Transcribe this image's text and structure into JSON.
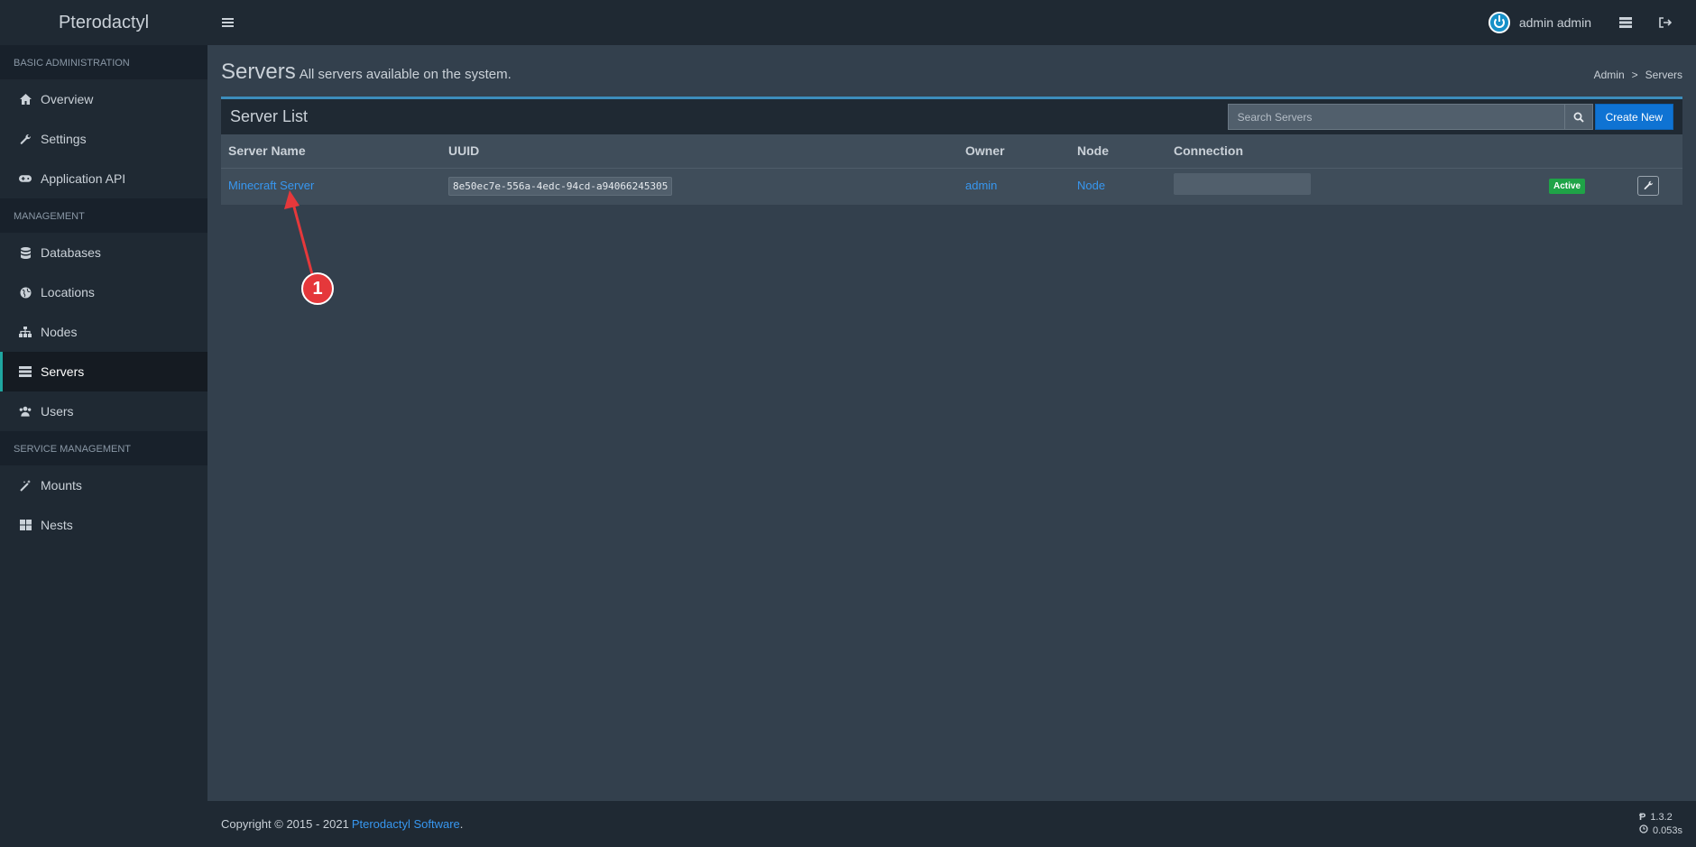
{
  "app": {
    "brand": "Pterodactyl"
  },
  "header": {
    "user_name": "admin admin"
  },
  "sidebar": {
    "sections": [
      {
        "title": "BASIC ADMINISTRATION",
        "items": [
          {
            "label": "Overview",
            "icon": "home-icon"
          },
          {
            "label": "Settings",
            "icon": "wrench-icon"
          },
          {
            "label": "Application API",
            "icon": "gamepad-icon"
          }
        ]
      },
      {
        "title": "MANAGEMENT",
        "items": [
          {
            "label": "Databases",
            "icon": "database-icon"
          },
          {
            "label": "Locations",
            "icon": "globe-icon"
          },
          {
            "label": "Nodes",
            "icon": "sitemap-icon"
          },
          {
            "label": "Servers",
            "icon": "server-icon",
            "active": true
          },
          {
            "label": "Users",
            "icon": "users-icon"
          }
        ]
      },
      {
        "title": "SERVICE MANAGEMENT",
        "items": [
          {
            "label": "Mounts",
            "icon": "magic-icon"
          },
          {
            "label": "Nests",
            "icon": "th-large-icon"
          }
        ]
      }
    ]
  },
  "page": {
    "title": "Servers",
    "subtitle": "All servers available on the system.",
    "breadcrumb": [
      "Admin",
      ">",
      "Servers"
    ]
  },
  "server_list": {
    "title": "Server List",
    "search_placeholder": "Search Servers",
    "create_label": "Create New",
    "columns": [
      "Server Name",
      "UUID",
      "Owner",
      "Node",
      "Connection"
    ],
    "rows": [
      {
        "name": "Minecraft Server",
        "uuid": "8e50ec7e-556a-4edc-94cd-a94066245305",
        "owner": "admin",
        "node": "Node",
        "connection": "",
        "status": "Active"
      }
    ]
  },
  "footer": {
    "copyright": "Copyright © 2015 - 2021",
    "company": "Pterodactyl Software",
    "period": ".",
    "version": "1.3.2",
    "time": "0.053s"
  },
  "annotation": {
    "marker": "1",
    "color": "#e5383b"
  }
}
